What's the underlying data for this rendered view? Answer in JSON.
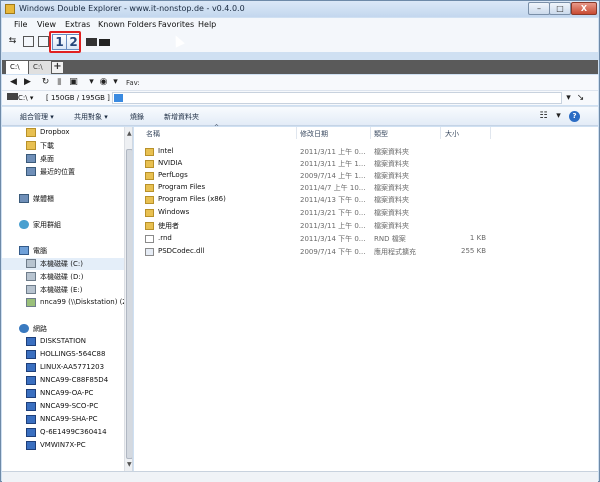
{
  "window": {
    "title": "Windows Double Explorer - www.it-nonstop.de - v0.4.0.0",
    "min_label": "–",
    "max_label": "□",
    "close_label": "X"
  },
  "menu": {
    "items": [
      "File",
      "View",
      "Extras",
      "Known Folders",
      "Favorites",
      "Help"
    ]
  },
  "toolbar": {
    "pane_one_label": "1",
    "pane_two_label": "2"
  },
  "tabs": {
    "active": "C:\\",
    "inactive": "C:\\",
    "add_label": "+"
  },
  "nav": {
    "fav_label": "Fav:"
  },
  "drivebar": {
    "drive": "C:\\ ▾",
    "size": "[ 150GB / 195GB ]"
  },
  "commands": {
    "items": [
      "組合管理 ▾",
      "共用對象 ▾",
      "燒錄",
      "新增資料夾"
    ]
  },
  "sidebar": {
    "items": [
      {
        "label": "Dropbox",
        "icon": "folder"
      },
      {
        "label": "下載",
        "icon": "folder"
      },
      {
        "label": "桌面",
        "icon": "folder"
      },
      {
        "label": "最近的位置",
        "icon": "folder"
      },
      {
        "label": "媒體櫃",
        "icon": "library"
      },
      {
        "label": "家用群組",
        "icon": "homegroup"
      },
      {
        "label": "電腦",
        "icon": "computer"
      },
      {
        "label": "本機磁碟 (C:)",
        "icon": "drive"
      },
      {
        "label": "本機磁碟 (D:)",
        "icon": "drive"
      },
      {
        "label": "本機磁碟 (E:)",
        "icon": "drive"
      },
      {
        "label": "nnca99 (\\\\Diskstation) (Z:)",
        "icon": "network-drive"
      },
      {
        "label": "網路",
        "icon": "network"
      },
      {
        "label": "DISKSTATION",
        "icon": "computer"
      },
      {
        "label": "HOLLINGS-564C88",
        "icon": "computer"
      },
      {
        "label": "LINUX-AA5771203",
        "icon": "computer"
      },
      {
        "label": "NNCA99-C88F85D4",
        "icon": "computer"
      },
      {
        "label": "NNCA99-OA-PC",
        "icon": "computer"
      },
      {
        "label": "NNCA99-SCO-PC",
        "icon": "computer"
      },
      {
        "label": "NNCA99-SHA-PC",
        "icon": "computer"
      },
      {
        "label": "Q-6E1499C360414",
        "icon": "computer"
      },
      {
        "label": "VMWIN7X-PC",
        "icon": "computer"
      }
    ]
  },
  "files": {
    "headers": {
      "name": "名稱",
      "date": "修改日期",
      "type": "類型",
      "size": "大小"
    },
    "rows": [
      {
        "name": "Intel",
        "date": "2011/3/11 上午 0...",
        "type": "檔案資料夾",
        "size": "",
        "icon": "folder"
      },
      {
        "name": "NVIDIA",
        "date": "2011/3/11 上午 1...",
        "type": "檔案資料夾",
        "size": "",
        "icon": "folder"
      },
      {
        "name": "PerfLogs",
        "date": "2009/7/14 上午 1...",
        "type": "檔案資料夾",
        "size": "",
        "icon": "folder"
      },
      {
        "name": "Program Files",
        "date": "2011/4/7 上午 10...",
        "type": "檔案資料夾",
        "size": "",
        "icon": "folder"
      },
      {
        "name": "Program Files (x86)",
        "date": "2011/4/13 下午 0...",
        "type": "檔案資料夾",
        "size": "",
        "icon": "folder"
      },
      {
        "name": "Windows",
        "date": "2011/3/21 下午 0...",
        "type": "檔案資料夾",
        "size": "",
        "icon": "folder"
      },
      {
        "name": "使用者",
        "date": "2011/3/11 上午 0...",
        "type": "檔案資料夾",
        "size": "",
        "icon": "folder"
      },
      {
        "name": ".rnd",
        "date": "2011/3/14 下午 0...",
        "type": "RND 檔案",
        "size": "1 KB",
        "icon": "file"
      },
      {
        "name": "PSDCodec.dll",
        "date": "2009/7/14 下午 0...",
        "type": "應用程式擴充",
        "size": "255 KB",
        "icon": "dll"
      }
    ]
  },
  "colors": {
    "titlebar": "#c3d7ee",
    "highlight": "#e02020",
    "tabstrip": "#5a5a5a",
    "folder": "#e8c051"
  }
}
